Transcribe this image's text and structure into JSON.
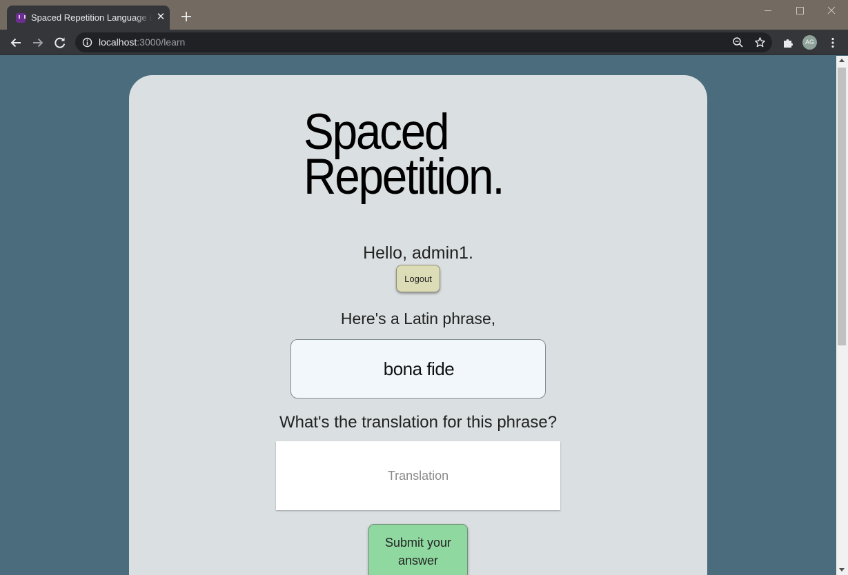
{
  "browser": {
    "tab_title": "Spaced Repetition Language Learning",
    "tab_close_glyph": "✕",
    "url_host": "localhost",
    "url_path": ":3000/learn",
    "profile_initials": "AG",
    "theme": {
      "titlebar": "#736b62",
      "toolbar": "#35363a",
      "omnibox": "#202124"
    }
  },
  "page": {
    "logo_line1": "Spaced",
    "logo_line2": "Repetition.",
    "greeting": "Hello, admin1.",
    "logout_label": "Logout",
    "prompt": "Here's a Latin phrase,",
    "phrase": "bona fide",
    "question": "What's the translation for this phrase?",
    "answer_placeholder": "Translation",
    "answer_value": "",
    "submit_label": "Submit your answer"
  },
  "colors": {
    "page_background": "#4a6c7c",
    "card_background": "#dadfe1",
    "phrase_box_background": "#f1f7fa",
    "logout_button": "#dcdcb7",
    "submit_button": "#8fd8a0"
  },
  "icons": [
    "back-icon",
    "forward-icon",
    "reload-icon",
    "info-icon",
    "zoom-icon",
    "bookmark-star-icon",
    "extensions-icon",
    "menu-icon"
  ]
}
